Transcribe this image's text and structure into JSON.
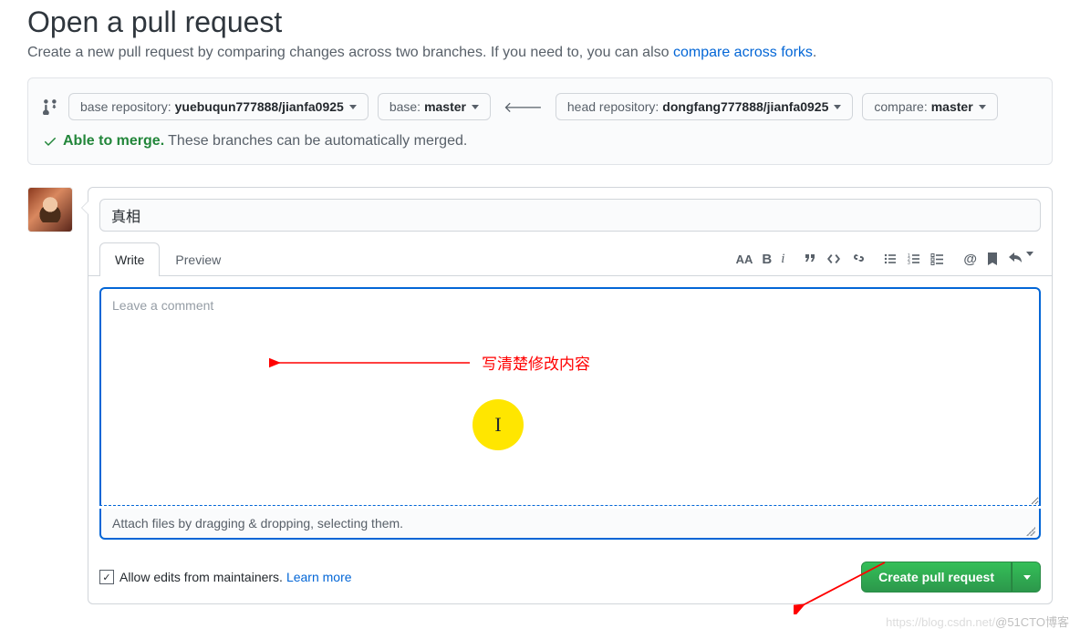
{
  "header": {
    "title": "Open a pull request",
    "subtitle_pre": "Create a new pull request by comparing changes across two branches. If you need to, you can also ",
    "subtitle_link": "compare across forks",
    "subtitle_post": "."
  },
  "compare": {
    "base_repo_label": "base repository: ",
    "base_repo_value": "yuebuqun777888/jianfa0925",
    "base_branch_label": "base: ",
    "base_branch_value": "master",
    "head_repo_label": "head repository: ",
    "head_repo_value": "dongfang777888/jianfa0925",
    "compare_branch_label": "compare: ",
    "compare_branch_value": "master"
  },
  "merge": {
    "ok_label": "Able to merge.",
    "rest": "These branches can be automatically merged."
  },
  "form": {
    "title_value": "真相",
    "tabs": {
      "write": "Write",
      "preview": "Preview"
    },
    "comment_placeholder": "Leave a comment",
    "attach_text": "Attach files by dragging & dropping, selecting them."
  },
  "footer": {
    "allow_edits": "Allow edits from maintainers.",
    "learn_more": "Learn more",
    "create_label": "Create pull request"
  },
  "annotation": {
    "text1": "写清楚修改内容"
  },
  "watermark": {
    "light": "https://blog.csdn.net/",
    "main": "@51CTO博客"
  }
}
